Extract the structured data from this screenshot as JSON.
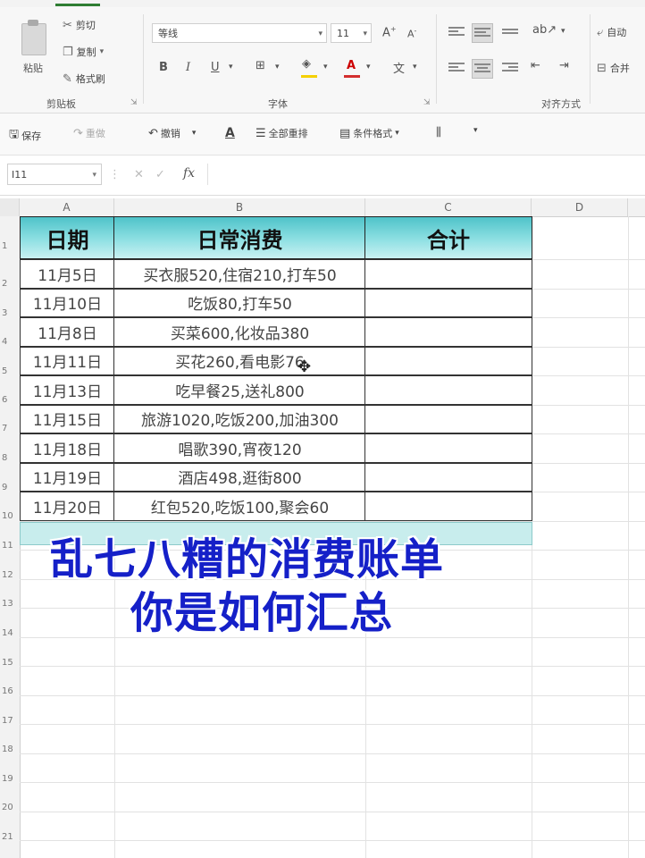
{
  "ribbon": {
    "clipboard": {
      "paste": "粘贴",
      "cut": "剪切",
      "copy": "复制",
      "format_painter": "格式刷",
      "group_label": "剪贴板"
    },
    "font": {
      "font_name": "等线",
      "font_size": "11",
      "group_label": "字体"
    },
    "alignment": {
      "group_label": "对齐方式",
      "wrap": "自动",
      "merge": "合并"
    }
  },
  "qat": {
    "save": "保存",
    "redo": "重做",
    "undo": "撤销",
    "clear_all": "全部重排",
    "conditional_format": "条件格式"
  },
  "formula_bar": {
    "name_box": "I11",
    "fx": "fx"
  },
  "columns": [
    "A",
    "B",
    "C",
    "D"
  ],
  "rows": [
    "1",
    "2",
    "3",
    "4",
    "5",
    "6",
    "7",
    "8",
    "9",
    "10",
    "11",
    "12",
    "13",
    "14",
    "15",
    "16",
    "17",
    "18",
    "19",
    "20",
    "21"
  ],
  "table": {
    "headers": [
      "日期",
      "日常消费",
      "合计"
    ],
    "rows": [
      {
        "date": "11月5日",
        "expense": "买衣服520,住宿210,打车50",
        "total": ""
      },
      {
        "date": "11月10日",
        "expense": "吃饭80,打车50",
        "total": ""
      },
      {
        "date": "11月8日",
        "expense": "买菜600,化妆品380",
        "total": ""
      },
      {
        "date": "11月11日",
        "expense": "买花260,看电影76",
        "total": ""
      },
      {
        "date": "11月13日",
        "expense": "吃早餐25,送礼800",
        "total": ""
      },
      {
        "date": "11月15日",
        "expense": "旅游1020,吃饭200,加油300",
        "total": ""
      },
      {
        "date": "11月18日",
        "expense": "唱歌390,宵夜120",
        "total": ""
      },
      {
        "date": "11月19日",
        "expense": "酒店498,逛街800",
        "total": ""
      },
      {
        "date": "11月20日",
        "expense": "红包520,吃饭100,聚会60",
        "total": ""
      }
    ]
  },
  "caption": {
    "line1": "乱七八糟的消费账单",
    "line2": "你是如何汇总"
  },
  "colors": {
    "header_fill": "#4fc3c9",
    "caption": "#1520c8"
  }
}
